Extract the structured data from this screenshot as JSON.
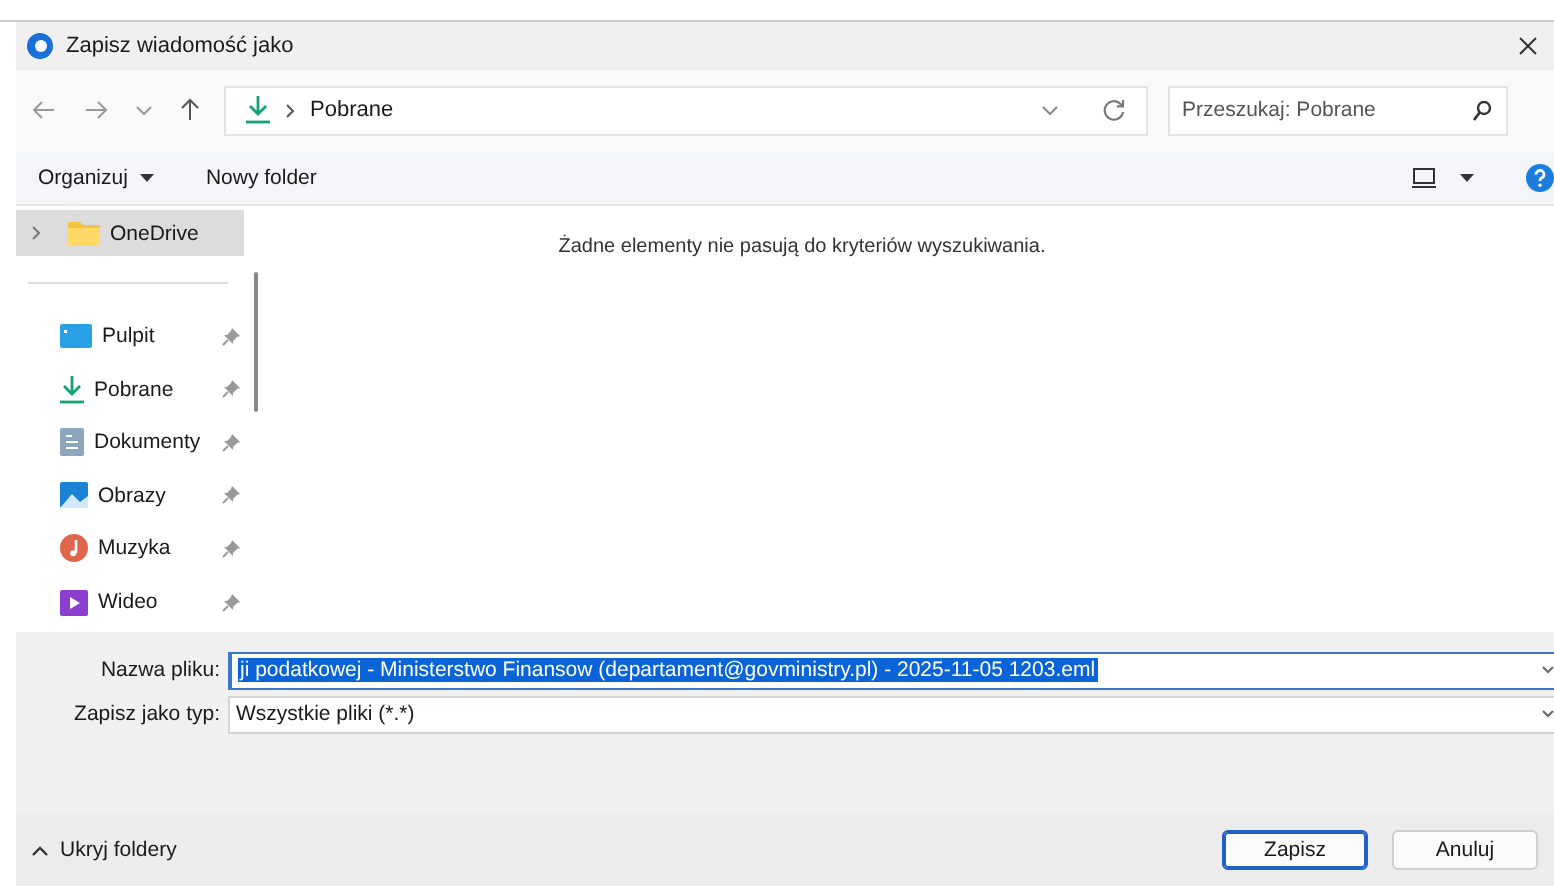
{
  "window": {
    "title": "Zapisz wiadomość jako"
  },
  "address_bar": {
    "path": "Pobrane"
  },
  "search": {
    "placeholder": "Przeszukaj: Pobrane"
  },
  "toolbar": {
    "organize": "Organizuj",
    "new_folder": "Nowy folder"
  },
  "sidebar": {
    "items": [
      {
        "label": "OneDrive",
        "kind": "onedrive",
        "selected": true,
        "pinned": false
      },
      {
        "label": "Pulpit",
        "kind": "desktop",
        "selected": false,
        "pinned": true
      },
      {
        "label": "Pobrane",
        "kind": "downloads",
        "selected": false,
        "pinned": true
      },
      {
        "label": "Dokumenty",
        "kind": "documents",
        "selected": false,
        "pinned": true
      },
      {
        "label": "Obrazy",
        "kind": "pictures",
        "selected": false,
        "pinned": true
      },
      {
        "label": "Muzyka",
        "kind": "music",
        "selected": false,
        "pinned": true
      },
      {
        "label": "Wideo",
        "kind": "video",
        "selected": false,
        "pinned": true
      }
    ]
  },
  "content": {
    "empty_message": "Żadne elementy nie pasują do kryteriów wyszukiwania."
  },
  "form": {
    "filename_label": "Nazwa pliku:",
    "filename_value": "ji podatkowej - Ministerstwo Finansow (departament@govministry.pl) - 2025-11-05 1203.eml",
    "type_label": "Zapisz jako typ:",
    "type_value": "Wszystkie pliki (*.*)"
  },
  "footer": {
    "hide_folders": "Ukryj foldery",
    "buttons": [
      {
        "label": "Zapisz",
        "selected": true
      },
      {
        "label": "Anuluj",
        "selected": false
      }
    ]
  }
}
